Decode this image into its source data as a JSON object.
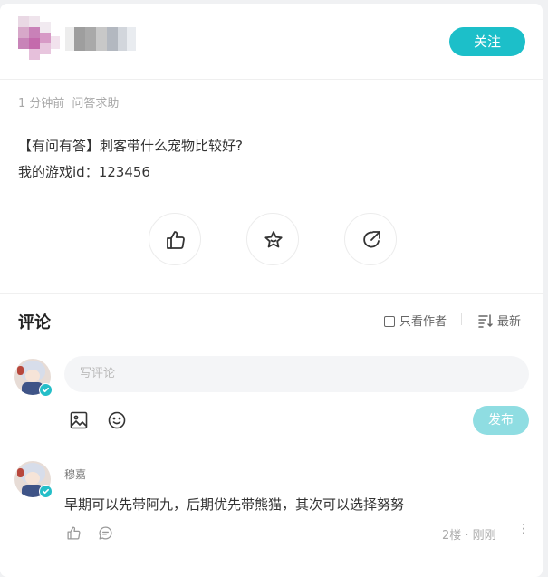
{
  "header": {
    "follow_label": "关注"
  },
  "post": {
    "time": "1 分钟前",
    "category": "问答求助",
    "title": "【有问有答】刺客带什么宠物比较好?",
    "body": "我的游戏id：123456"
  },
  "actions": {
    "like_icon": "thumbs-up-icon",
    "favorite_icon": "star-icon",
    "share_icon": "share-arrow-icon"
  },
  "comments": {
    "title": "评论",
    "only_author_label": "只看作者",
    "sort_label": "最新",
    "input_placeholder": "写评论",
    "publish_label": "发布",
    "items": [
      {
        "user": "穆嘉",
        "text": "早期可以先带阿九，后期优先带熊猫，其次可以选择努努",
        "meta": "2楼 · 刚刚",
        "more": "⋮"
      }
    ]
  },
  "colors": {
    "accent": "#1cbfc9",
    "publish_disabled": "#8fdde2",
    "muted_text": "#a8a8a8"
  }
}
